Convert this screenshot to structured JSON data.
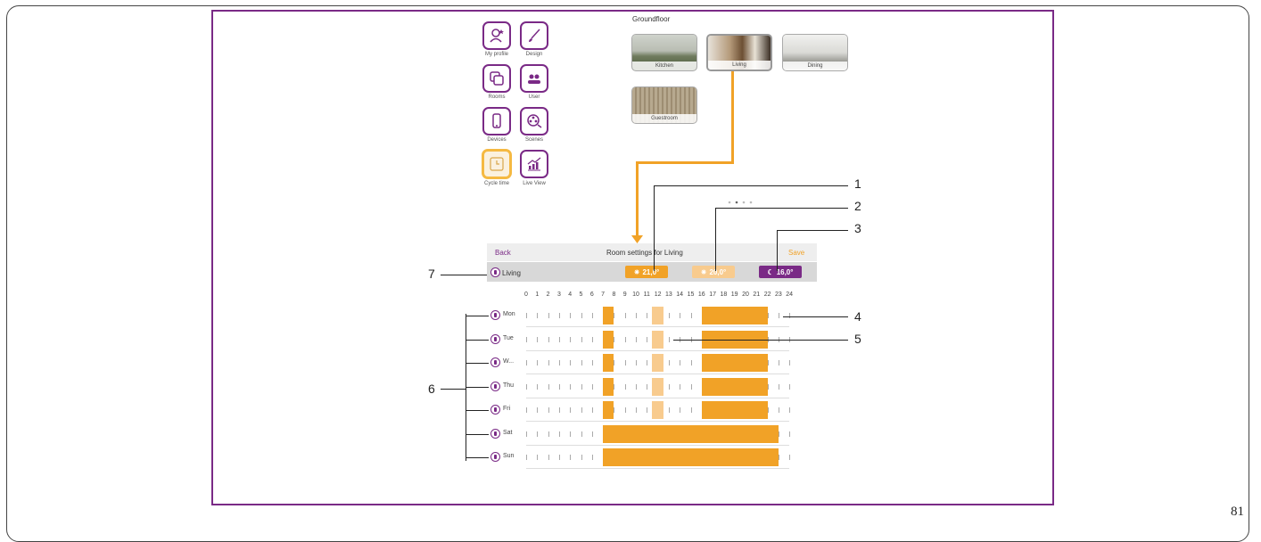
{
  "page_number": "81",
  "menu": [
    {
      "key": "my_profile",
      "label": "My profile",
      "icon": "profile-icon"
    },
    {
      "key": "design",
      "label": "Design",
      "icon": "brush-icon"
    },
    {
      "key": "rooms",
      "label": "Rooms",
      "icon": "rooms-icon"
    },
    {
      "key": "user",
      "label": "User",
      "icon": "users-icon"
    },
    {
      "key": "devices",
      "label": "Devices",
      "icon": "phone-icon"
    },
    {
      "key": "scenes",
      "label": "Scenes",
      "icon": "film-reel-icon"
    },
    {
      "key": "cycle_time",
      "label": "Cycle time",
      "icon": "clock-icon",
      "active": true
    },
    {
      "key": "live_view",
      "label": "Live View",
      "icon": "chart-icon"
    }
  ],
  "floor": {
    "title": "Groundfloor",
    "rooms": [
      {
        "label": "Kitchen",
        "selected": false
      },
      {
        "label": "Living",
        "selected": true
      },
      {
        "label": "Dining",
        "selected": false
      },
      {
        "label": "Guestroom",
        "selected": false
      }
    ]
  },
  "room_settings": {
    "back_label": "Back",
    "title": "Room settings for Living",
    "save_label": "Save",
    "room_name": "Living",
    "comfort_temp": "21,0°",
    "eco_temp": "20,0°",
    "night_temp": "16,0°"
  },
  "hours": [
    "0",
    "1",
    "2",
    "3",
    "4",
    "5",
    "6",
    "7",
    "8",
    "9",
    "10",
    "11",
    "12",
    "13",
    "14",
    "15",
    "16",
    "17",
    "18",
    "19",
    "20",
    "21",
    "22",
    "23",
    "24"
  ],
  "days": [
    {
      "label": "Mon",
      "blocks": [
        {
          "type": "comfort",
          "start": 7,
          "end": 8
        },
        {
          "type": "eco",
          "start": 11.5,
          "end": 12.5
        },
        {
          "type": "comfort",
          "start": 16,
          "end": 22
        }
      ]
    },
    {
      "label": "Tue",
      "blocks": [
        {
          "type": "comfort",
          "start": 7,
          "end": 8
        },
        {
          "type": "eco",
          "start": 11.5,
          "end": 12.5
        },
        {
          "type": "comfort",
          "start": 16,
          "end": 22
        }
      ]
    },
    {
      "label": "W...",
      "blocks": [
        {
          "type": "comfort",
          "start": 7,
          "end": 8
        },
        {
          "type": "eco",
          "start": 11.5,
          "end": 12.5
        },
        {
          "type": "comfort",
          "start": 16,
          "end": 22
        }
      ]
    },
    {
      "label": "Thu",
      "blocks": [
        {
          "type": "comfort",
          "start": 7,
          "end": 8
        },
        {
          "type": "eco",
          "start": 11.5,
          "end": 12.5
        },
        {
          "type": "comfort",
          "start": 16,
          "end": 22
        }
      ]
    },
    {
      "label": "Fri",
      "blocks": [
        {
          "type": "comfort",
          "start": 7,
          "end": 8
        },
        {
          "type": "eco",
          "start": 11.5,
          "end": 12.5
        },
        {
          "type": "comfort",
          "start": 16,
          "end": 22
        }
      ]
    },
    {
      "label": "Sat",
      "blocks": [
        {
          "type": "comfort",
          "start": 7,
          "end": 23
        }
      ]
    },
    {
      "label": "Sun",
      "blocks": [
        {
          "type": "comfort",
          "start": 7,
          "end": 23
        }
      ]
    }
  ],
  "callouts": [
    "1",
    "2",
    "3",
    "4",
    "5",
    "6",
    "7"
  ],
  "colors": {
    "accent": "#7a2a86",
    "comfort": "#f1a227",
    "eco": "#f8cb8e",
    "night": "#7a2a86",
    "save": "#f1a227"
  }
}
